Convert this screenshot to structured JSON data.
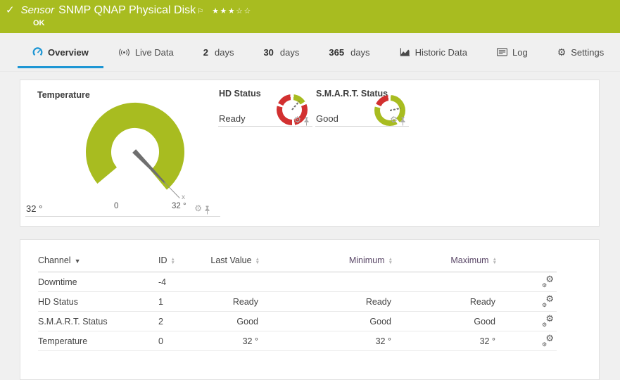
{
  "topbar": {
    "check": "✓",
    "kind": "Sensor",
    "title": "SNMP QNAP Physical Disk",
    "flag": "⚐",
    "stars": "★★★☆☆",
    "status": "OK"
  },
  "tabs": {
    "overview": "Overview",
    "live": "Live Data",
    "d2_num": "2",
    "d2_unit": "days",
    "d30_num": "30",
    "d30_unit": "days",
    "d365_num": "365",
    "d365_unit": "days",
    "historic": "Historic Data",
    "log": "Log",
    "settings": "Settings"
  },
  "gauges": {
    "temperature": {
      "title": "Temperature",
      "value": "32 °",
      "scale_min": "0",
      "scale_max": "32 °",
      "needle_marker": "x"
    },
    "hd": {
      "title": "HD Status",
      "value": "Ready"
    },
    "smart": {
      "title": "S.M.A.R.T. Status",
      "value": "Good"
    }
  },
  "table": {
    "headers": {
      "channel": "Channel",
      "id": "ID",
      "last": "Last Value",
      "min": "Minimum",
      "max": "Maximum"
    },
    "rows": [
      {
        "channel": "Downtime",
        "id": "-4",
        "last": "",
        "min": "",
        "max": ""
      },
      {
        "channel": "HD Status",
        "id": "1",
        "last": "Ready",
        "min": "Ready",
        "max": "Ready"
      },
      {
        "channel": "S.M.A.R.T. Status",
        "id": "2",
        "last": "Good",
        "min": "Good",
        "max": "Good"
      },
      {
        "channel": "Temperature",
        "id": "0",
        "last": "32 °",
        "min": "32 °",
        "max": "32 °"
      }
    ]
  },
  "colors": {
    "ok_green": "#a8bc20",
    "alarm_red": "#d23030",
    "accent_blue": "#1e96d4"
  }
}
